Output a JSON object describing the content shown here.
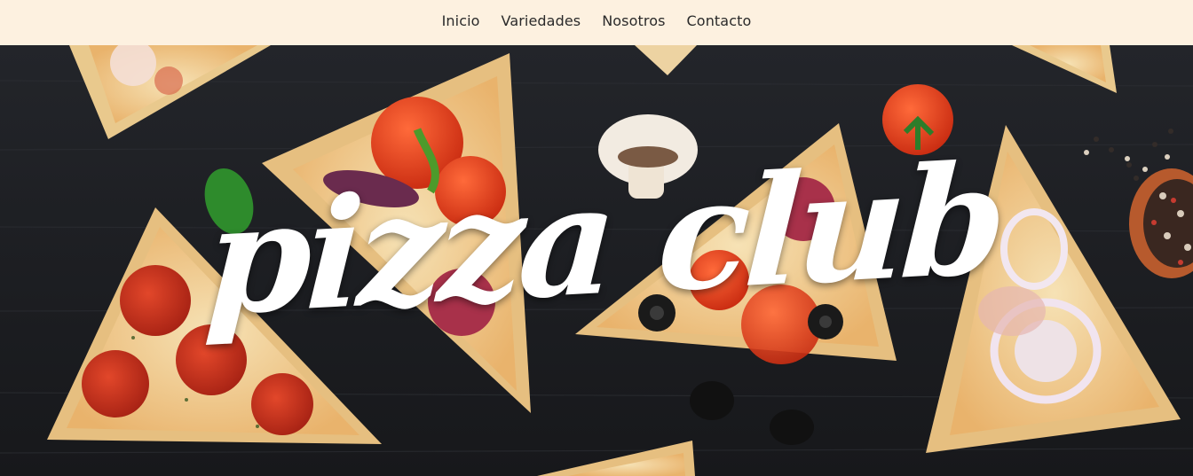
{
  "nav": {
    "items": [
      {
        "label": "Inicio"
      },
      {
        "label": "Variedades"
      },
      {
        "label": "Nosotros"
      },
      {
        "label": "Contacto"
      }
    ]
  },
  "hero": {
    "brand_title": "pizza club",
    "image_icon": "pizza-photo-icon"
  },
  "colors": {
    "nav_background": "#fdf1e0",
    "hero_background": "#1f2023",
    "title_color": "#ffffff"
  }
}
